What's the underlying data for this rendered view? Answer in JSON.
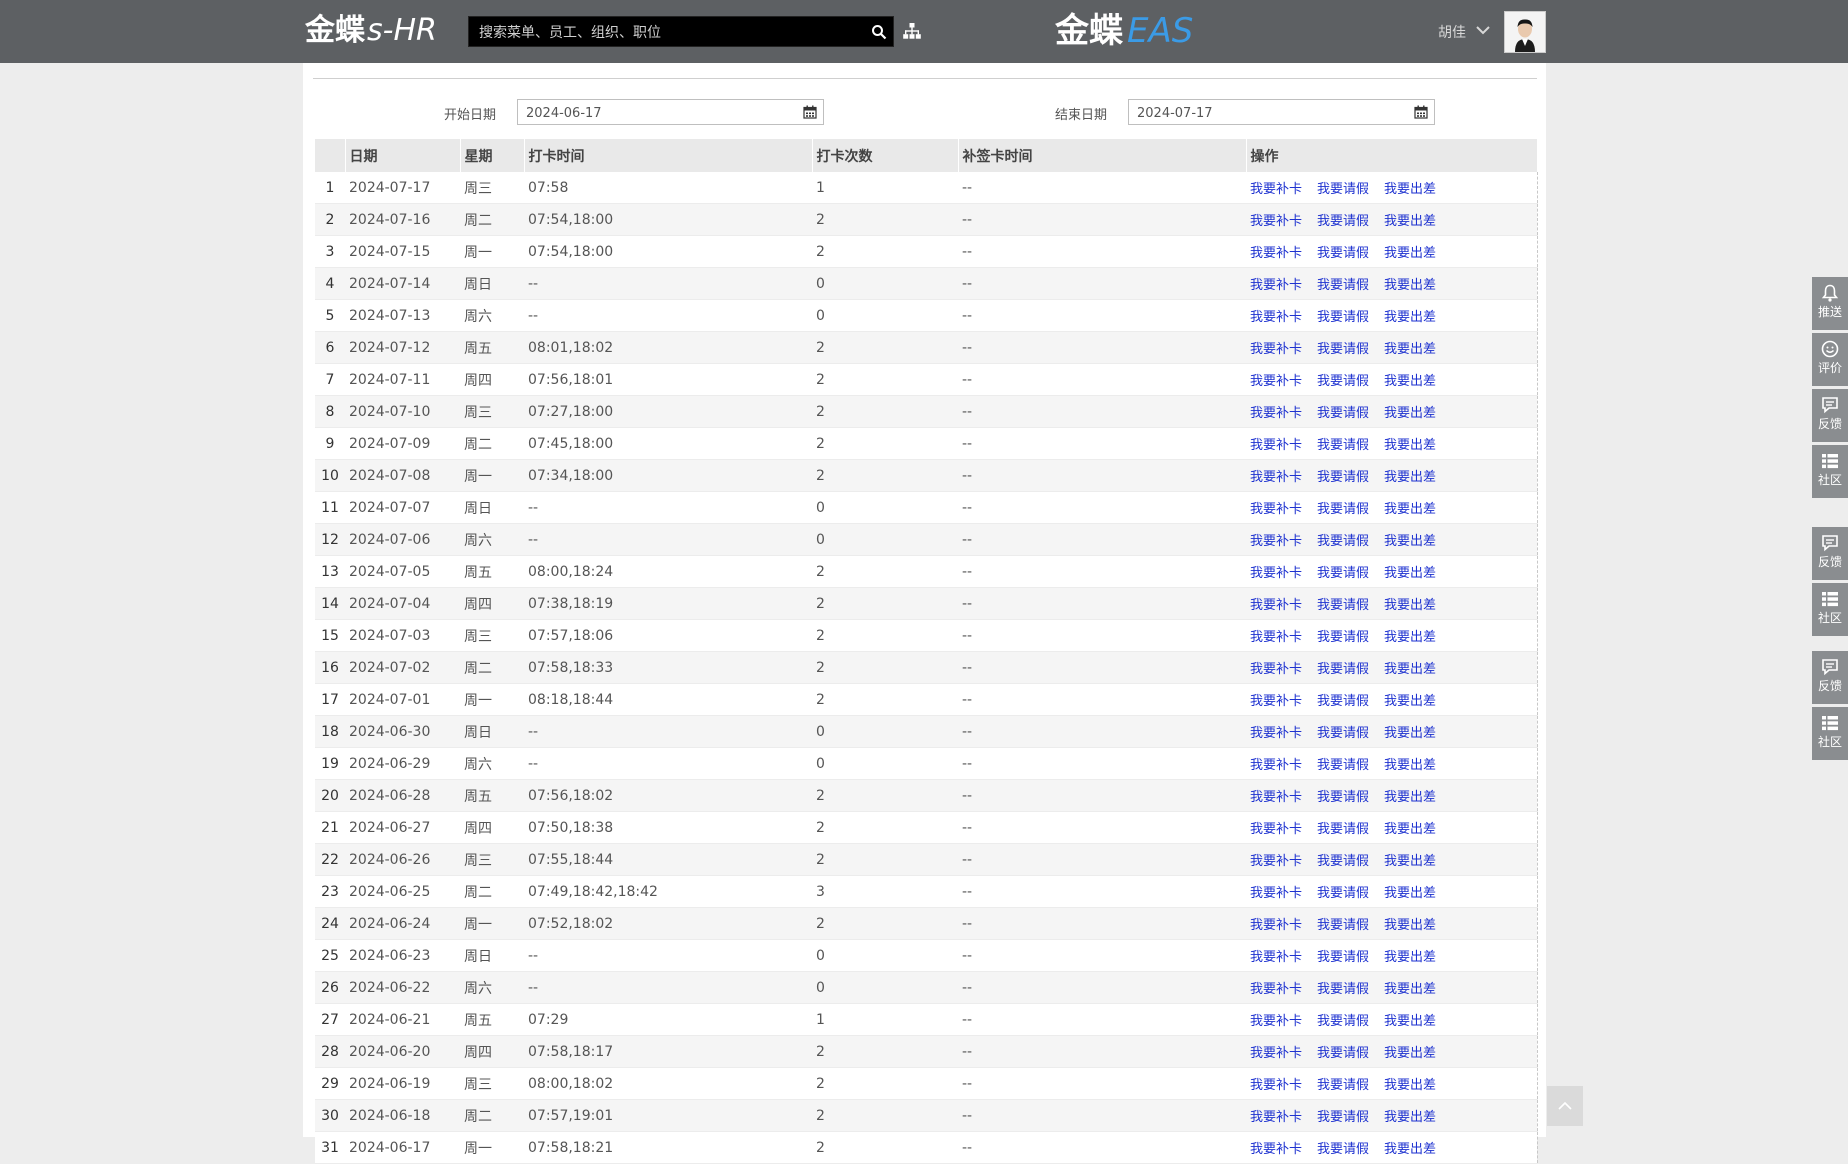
{
  "header": {
    "shr_logo_cn": "金蝶",
    "shr_logo_en": "s-HR",
    "search_placeholder": "搜索菜单、员工、组织、职位",
    "eas_logo_cn": "金蝶",
    "eas_logo_en": "EAS",
    "username": "胡佳"
  },
  "filters": {
    "start_label": "开始日期",
    "start_value": "2024-06-17",
    "end_label": "结束日期",
    "end_value": "2024-07-17"
  },
  "table": {
    "columns": [
      "日期",
      "星期",
      "打卡时间",
      "打卡次数",
      "补签卡时间",
      "操作"
    ],
    "actions": [
      "我要补卡",
      "我要请假",
      "我要出差"
    ],
    "rows": [
      {
        "no": "1",
        "date": "2024-07-17",
        "weekday": "周三",
        "times": "07:58",
        "count": "1",
        "resign": "--"
      },
      {
        "no": "2",
        "date": "2024-07-16",
        "weekday": "周二",
        "times": "07:54,18:00",
        "count": "2",
        "resign": "--"
      },
      {
        "no": "3",
        "date": "2024-07-15",
        "weekday": "周一",
        "times": "07:54,18:00",
        "count": "2",
        "resign": "--"
      },
      {
        "no": "4",
        "date": "2024-07-14",
        "weekday": "周日",
        "times": "--",
        "count": "0",
        "resign": "--"
      },
      {
        "no": "5",
        "date": "2024-07-13",
        "weekday": "周六",
        "times": "--",
        "count": "0",
        "resign": "--"
      },
      {
        "no": "6",
        "date": "2024-07-12",
        "weekday": "周五",
        "times": "08:01,18:02",
        "count": "2",
        "resign": "--"
      },
      {
        "no": "7",
        "date": "2024-07-11",
        "weekday": "周四",
        "times": "07:56,18:01",
        "count": "2",
        "resign": "--"
      },
      {
        "no": "8",
        "date": "2024-07-10",
        "weekday": "周三",
        "times": "07:27,18:00",
        "count": "2",
        "resign": "--"
      },
      {
        "no": "9",
        "date": "2024-07-09",
        "weekday": "周二",
        "times": "07:45,18:00",
        "count": "2",
        "resign": "--"
      },
      {
        "no": "10",
        "date": "2024-07-08",
        "weekday": "周一",
        "times": "07:34,18:00",
        "count": "2",
        "resign": "--"
      },
      {
        "no": "11",
        "date": "2024-07-07",
        "weekday": "周日",
        "times": "--",
        "count": "0",
        "resign": "--"
      },
      {
        "no": "12",
        "date": "2024-07-06",
        "weekday": "周六",
        "times": "--",
        "count": "0",
        "resign": "--"
      },
      {
        "no": "13",
        "date": "2024-07-05",
        "weekday": "周五",
        "times": "08:00,18:24",
        "count": "2",
        "resign": "--"
      },
      {
        "no": "14",
        "date": "2024-07-04",
        "weekday": "周四",
        "times": "07:38,18:19",
        "count": "2",
        "resign": "--"
      },
      {
        "no": "15",
        "date": "2024-07-03",
        "weekday": "周三",
        "times": "07:57,18:06",
        "count": "2",
        "resign": "--"
      },
      {
        "no": "16",
        "date": "2024-07-02",
        "weekday": "周二",
        "times": "07:58,18:33",
        "count": "2",
        "resign": "--"
      },
      {
        "no": "17",
        "date": "2024-07-01",
        "weekday": "周一",
        "times": "08:18,18:44",
        "count": "2",
        "resign": "--"
      },
      {
        "no": "18",
        "date": "2024-06-30",
        "weekday": "周日",
        "times": "--",
        "count": "0",
        "resign": "--"
      },
      {
        "no": "19",
        "date": "2024-06-29",
        "weekday": "周六",
        "times": "--",
        "count": "0",
        "resign": "--"
      },
      {
        "no": "20",
        "date": "2024-06-28",
        "weekday": "周五",
        "times": "07:56,18:02",
        "count": "2",
        "resign": "--"
      },
      {
        "no": "21",
        "date": "2024-06-27",
        "weekday": "周四",
        "times": "07:50,18:38",
        "count": "2",
        "resign": "--"
      },
      {
        "no": "22",
        "date": "2024-06-26",
        "weekday": "周三",
        "times": "07:55,18:44",
        "count": "2",
        "resign": "--"
      },
      {
        "no": "23",
        "date": "2024-06-25",
        "weekday": "周二",
        "times": "07:49,18:42,18:42",
        "count": "3",
        "resign": "--"
      },
      {
        "no": "24",
        "date": "2024-06-24",
        "weekday": "周一",
        "times": "07:52,18:02",
        "count": "2",
        "resign": "--"
      },
      {
        "no": "25",
        "date": "2024-06-23",
        "weekday": "周日",
        "times": "--",
        "count": "0",
        "resign": "--"
      },
      {
        "no": "26",
        "date": "2024-06-22",
        "weekday": "周六",
        "times": "--",
        "count": "0",
        "resign": "--"
      },
      {
        "no": "27",
        "date": "2024-06-21",
        "weekday": "周五",
        "times": "07:29",
        "count": "1",
        "resign": "--"
      },
      {
        "no": "28",
        "date": "2024-06-20",
        "weekday": "周四",
        "times": "07:58,18:17",
        "count": "2",
        "resign": "--"
      },
      {
        "no": "29",
        "date": "2024-06-19",
        "weekday": "周三",
        "times": "08:00,18:02",
        "count": "2",
        "resign": "--"
      },
      {
        "no": "30",
        "date": "2024-06-18",
        "weekday": "周二",
        "times": "07:57,19:01",
        "count": "2",
        "resign": "--"
      },
      {
        "no": "31",
        "date": "2024-06-17",
        "weekday": "周一",
        "times": "07:58,18:21",
        "count": "2",
        "resign": "--"
      }
    ]
  },
  "sidebar": [
    {
      "label": "推送",
      "icon": "bell-icon"
    },
    {
      "label": "评价",
      "icon": "smiley-icon"
    },
    {
      "label": "反馈",
      "icon": "chat-icon"
    },
    {
      "label": "社区",
      "icon": "grid-icon"
    },
    {
      "label": "反馈",
      "icon": "chat-icon"
    },
    {
      "label": "社区",
      "icon": "grid-icon"
    },
    {
      "label": "反馈",
      "icon": "chat-icon"
    },
    {
      "label": "社区",
      "icon": "grid-icon"
    }
  ]
}
